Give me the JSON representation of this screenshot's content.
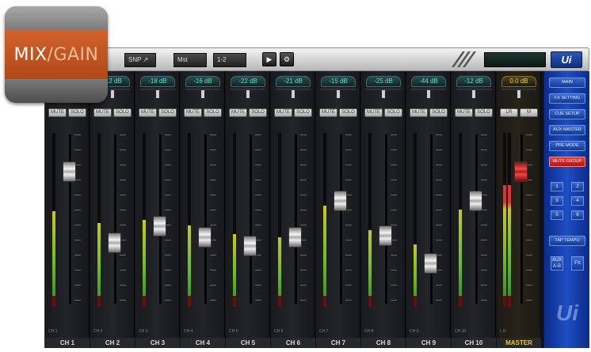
{
  "tile": {
    "word1": "MIX",
    "slash": "/",
    "word2": "GAIN"
  },
  "toolbar": {
    "btn_a": "SNP ↗",
    "btn_b": "Mst",
    "btn_c": "1-2",
    "play_icon": "play-icon",
    "settings_icon": "gear-icon",
    "brand": "Ui"
  },
  "channels": [
    {
      "name": "CH 1",
      "small": "CH 1",
      "gain": "-12 dB",
      "mute": "MUTE",
      "solo": "SOLO",
      "fader": 0.82,
      "meter": 0.55
    },
    {
      "name": "CH 2",
      "small": "CH 2",
      "gain": "-12 dB",
      "mute": "MUTE",
      "solo": "SOLO",
      "fader": 0.34,
      "meter": 0.48
    },
    {
      "name": "CH 3",
      "small": "CH 3",
      "gain": "-18 dB",
      "mute": "MUTE",
      "solo": "SOLO",
      "fader": 0.45,
      "meter": 0.5
    },
    {
      "name": "CH 4",
      "small": "CH 4",
      "gain": "-16 dB",
      "mute": "MUTE",
      "solo": "SOLO",
      "fader": 0.38,
      "meter": 0.47
    },
    {
      "name": "CH 5",
      "small": "CH 5",
      "gain": "-22 dB",
      "mute": "MUTE",
      "solo": "SOLO",
      "fader": 0.32,
      "meter": 0.42
    },
    {
      "name": "CH 6",
      "small": "CH 6",
      "gain": "-21 dB",
      "mute": "MUTE",
      "solo": "SOLO",
      "fader": 0.38,
      "meter": 0.4
    },
    {
      "name": "CH 7",
      "small": "CH 7",
      "gain": "-15 dB",
      "mute": "MUTE",
      "solo": "SOLO",
      "fader": 0.62,
      "meter": 0.58
    },
    {
      "name": "CH 8",
      "small": "CH 8",
      "gain": "-25 dB",
      "mute": "MUTE",
      "solo": "SOLO",
      "fader": 0.39,
      "meter": 0.44
    },
    {
      "name": "CH 9",
      "small": "CH 9",
      "gain": "-44 dB",
      "mute": "MUTE",
      "solo": "SOLO",
      "fader": 0.2,
      "meter": 0.36
    },
    {
      "name": "CH 10",
      "small": "CH 10",
      "gain": "-12 dB",
      "mute": "MUTE",
      "solo": "SOLO",
      "fader": 0.62,
      "meter": 0.56
    }
  ],
  "master": {
    "name": "MASTER",
    "small": "L   R",
    "gain": "0.0 dB",
    "btn_l": "LR",
    "btn_r": "M",
    "fader": 0.82,
    "meter": 0.7
  },
  "right_panel": {
    "buttons": [
      "MAIN",
      "FX SETTING",
      "CUE SETUP",
      "AUX MASTER",
      "PRE MODE",
      "MUTE GROUP"
    ],
    "red_button_index": 5,
    "grid": [
      "1",
      "2",
      "3",
      "4",
      "5",
      "6"
    ],
    "tap_button": "TAP TEMPO",
    "small_a": "AUX A-B",
    "small_b": "FX",
    "logo": "Ui"
  },
  "colors": {
    "accent_orange": "#c4541f",
    "panel_blue": "#1e4ec2",
    "gain_teal": "#5fe1d6",
    "master_yellow": "#f0c330"
  }
}
